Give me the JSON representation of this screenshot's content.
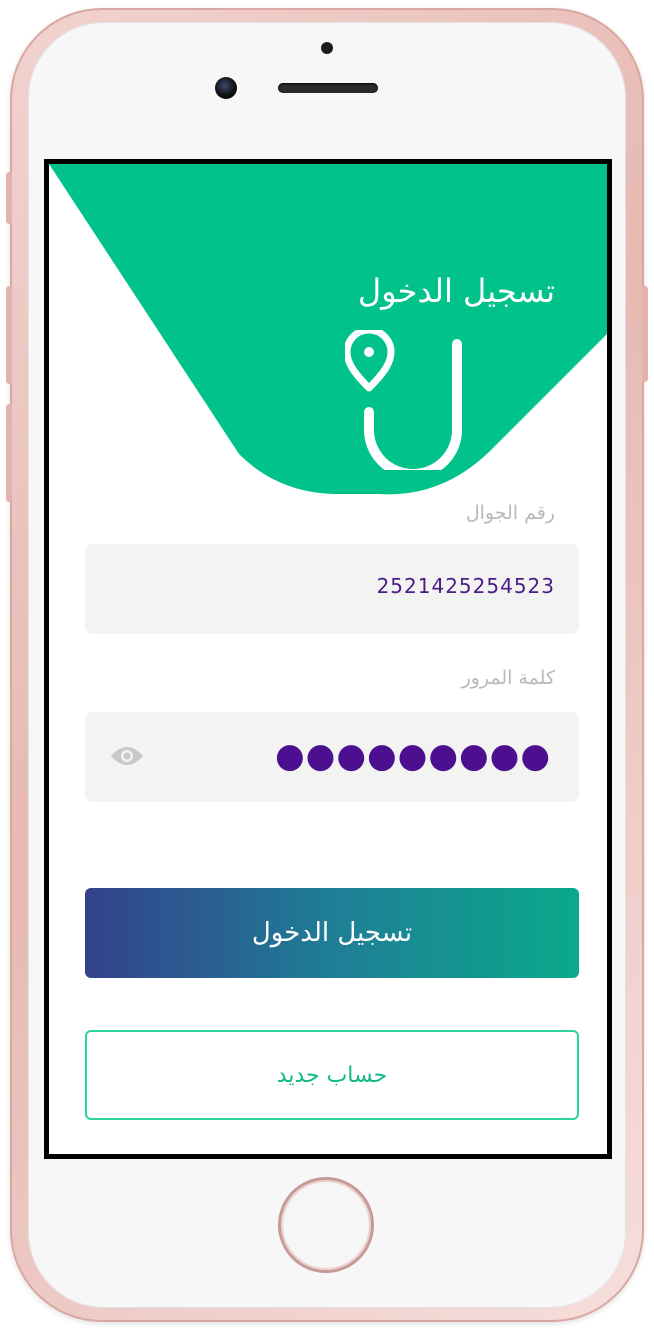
{
  "screen": {
    "title": "تسجيل الدخول",
    "brand_color": "#00c28a"
  },
  "phone_field": {
    "label": "رقم الجوال",
    "value": "2521425254523"
  },
  "password_field": {
    "label": "كلمة المرور",
    "value": "●●●●●●●●●"
  },
  "buttons": {
    "login_label": "تسجيل الدخول",
    "register_label": "حساب جديد"
  },
  "icons": {
    "logo": "location-pin-u-logo-icon",
    "password_toggle": "eye-icon"
  }
}
